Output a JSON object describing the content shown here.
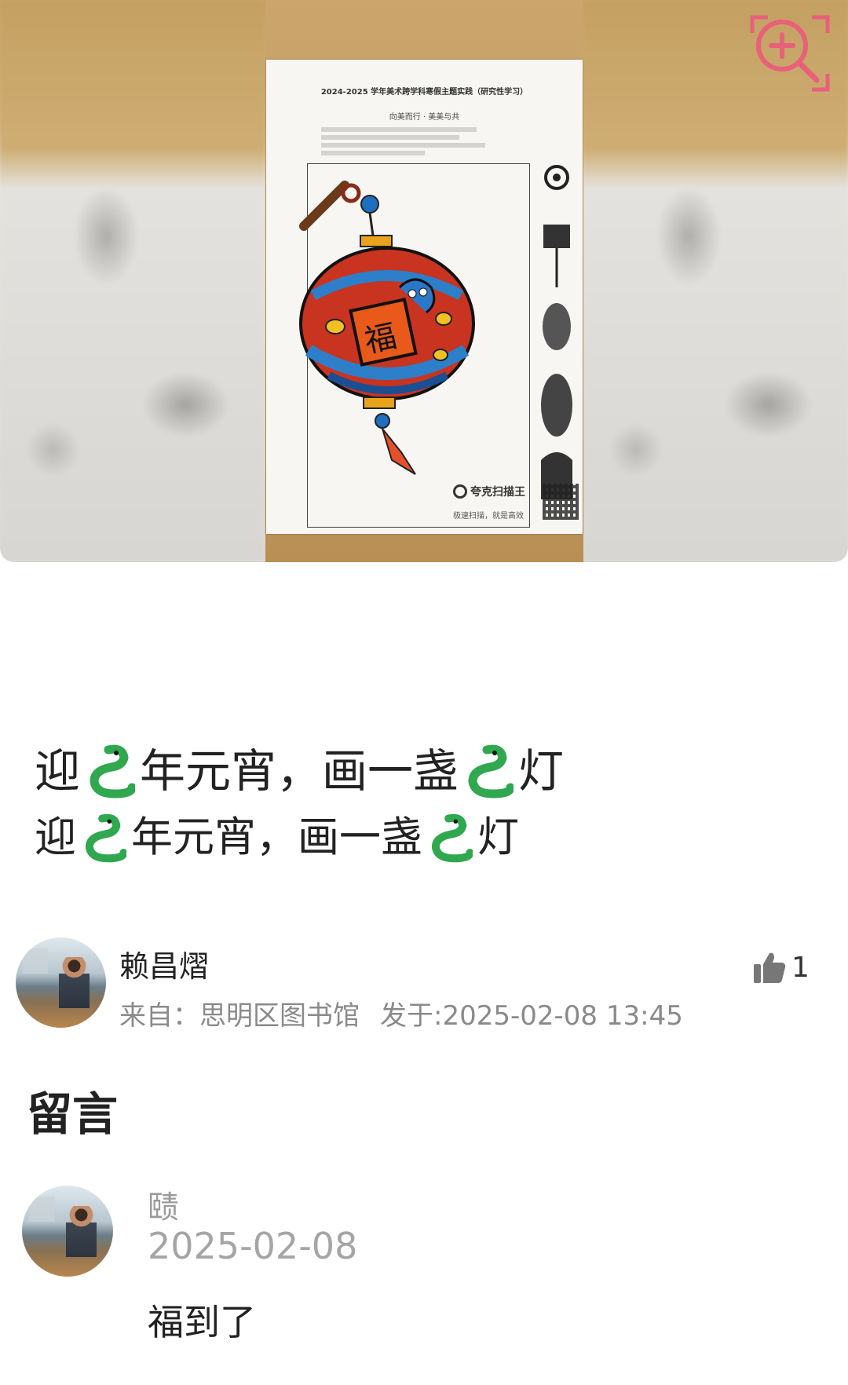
{
  "photo": {
    "sheet_header": "2024-2025 学年美术跨学科寒假主题实践（研究性学习）",
    "sheet_subtitle": "向美而行 · 美美与共",
    "center_character": "福",
    "scan_app_name": "夸克扫描王",
    "scan_app_slogan": "极速扫描，就是高效",
    "zoom_icon": "zoom-in-icon"
  },
  "post": {
    "title_line1": {
      "pre": "迎",
      "mid": "年元宵，画一盏",
      "post": "灯",
      "emoji": "snake-emoji-icon"
    },
    "title_line2": {
      "pre": "迎",
      "mid": "年元宵，画一盏",
      "post": "灯",
      "emoji": "snake-emoji-icon"
    }
  },
  "author": {
    "name": "赖昌熠",
    "source_label": "来自：思明区图书馆",
    "posted_label": "发于:2025-02-08 13:45",
    "like_icon": "thumbs-up-icon",
    "like_count": "1"
  },
  "comments_section": {
    "title": "留言",
    "items": [
      {
        "name": "赜",
        "date": "2025-02-08",
        "text": "福到了"
      }
    ]
  },
  "colors": {
    "snake_green": "#2fa84f",
    "meta_gray": "#8a8a8a",
    "zoom_pink": "#e8607a",
    "text_dark": "#222222"
  }
}
